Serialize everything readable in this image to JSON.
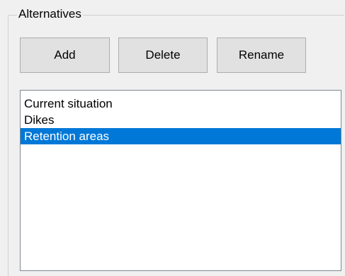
{
  "groupbox": {
    "title": "Alternatives"
  },
  "buttons": {
    "add_label": "Add",
    "delete_label": "Delete",
    "rename_label": "Rename"
  },
  "alternatives_list": {
    "items": [
      {
        "label": "Current situation",
        "selected": false
      },
      {
        "label": "Dikes",
        "selected": false
      },
      {
        "label": "Retention areas",
        "selected": true
      }
    ]
  },
  "colors": {
    "selection": "#0078d7",
    "background": "#f0f0f0",
    "button_face": "#e1e1e1"
  }
}
